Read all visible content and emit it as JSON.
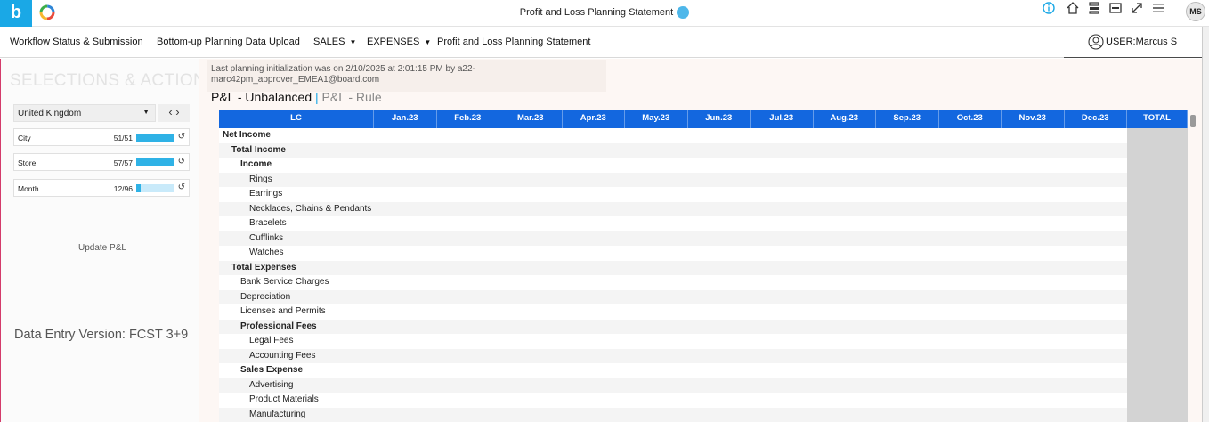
{
  "app": {
    "title": "Profit and Loss Planning Statement",
    "logo_letter": "b",
    "avatar_initials": "MS"
  },
  "nav": {
    "items": [
      {
        "label": "Workflow Status & Submission",
        "caret": ""
      },
      {
        "label": "Bottom-up Planning Data Upload",
        "caret": ""
      },
      {
        "label": "SALES",
        "caret": "▼"
      },
      {
        "label": "EXPENSES",
        "caret": "▼"
      },
      {
        "label": "Profit and Loss Planning Statement",
        "caret": ""
      }
    ],
    "user_label": "USER:Marcus S"
  },
  "selections": {
    "title": "SELECTIONS & ACTIONS",
    "country": "United Kingdom",
    "arrows": "‹ ›",
    "filters": [
      {
        "name": "City",
        "count": "51/51",
        "fraction": 1.0
      },
      {
        "name": "Store",
        "count": "57/57",
        "fraction": 1.0
      },
      {
        "name": "Month",
        "count": "12/96",
        "fraction": 0.125
      }
    ],
    "update_label": "Update P&L",
    "version_label": "Data Entry Version: FCST 3+9"
  },
  "report": {
    "info": "Last planning initialization was on 2/10/2025 at 2:01:15 PM by a22-marc42pm_approver_EMEA1@board.com",
    "tab_active": "P&L - Unbalanced",
    "tab_sep": "|",
    "tab_inactive": "P&L - Rule"
  },
  "grid": {
    "columns": [
      "LC",
      "Jan.23",
      "Feb.23",
      "Mar.23",
      "Apr.23",
      "May.23",
      "Jun.23",
      "Jul.23",
      "Aug.23",
      "Sep.23",
      "Oct.23",
      "Nov.23",
      "Dec.23",
      "TOTAL"
    ],
    "rows": [
      {
        "label": "Net Income",
        "level": 0,
        "bold": true
      },
      {
        "label": "Total Income",
        "level": 1,
        "bold": true
      },
      {
        "label": "Income",
        "level": 2,
        "bold": true
      },
      {
        "label": "Rings",
        "level": 3,
        "bold": false
      },
      {
        "label": "Earrings",
        "level": 3,
        "bold": false
      },
      {
        "label": "Necklaces, Chains & Pendants",
        "level": 3,
        "bold": false
      },
      {
        "label": "Bracelets",
        "level": 3,
        "bold": false
      },
      {
        "label": "Cufflinks",
        "level": 3,
        "bold": false
      },
      {
        "label": "Watches",
        "level": 3,
        "bold": false
      },
      {
        "label": "Total Expenses",
        "level": 1,
        "bold": true
      },
      {
        "label": "Bank Service Charges",
        "level": 2,
        "bold": false
      },
      {
        "label": "Depreciation",
        "level": 2,
        "bold": false
      },
      {
        "label": "Licenses and Permits",
        "level": 2,
        "bold": false
      },
      {
        "label": "Professional Fees",
        "level": 2,
        "bold": true
      },
      {
        "label": "Legal Fees",
        "level": 3,
        "bold": false
      },
      {
        "label": "Accounting Fees",
        "level": 3,
        "bold": false
      },
      {
        "label": "Sales Expense",
        "level": 2,
        "bold": true
      },
      {
        "label": "Advertising",
        "level": 3,
        "bold": false
      },
      {
        "label": "Product Materials",
        "level": 3,
        "bold": false
      },
      {
        "label": "Manufacturing",
        "level": 3,
        "bold": false
      }
    ]
  },
  "icons": {
    "topbar": [
      "info-icon",
      "home-icon",
      "filter-panel-icon",
      "screen-icon",
      "expand-icon",
      "menu-icon"
    ],
    "user": "user-circle-icon",
    "reset": "reset-icon"
  }
}
